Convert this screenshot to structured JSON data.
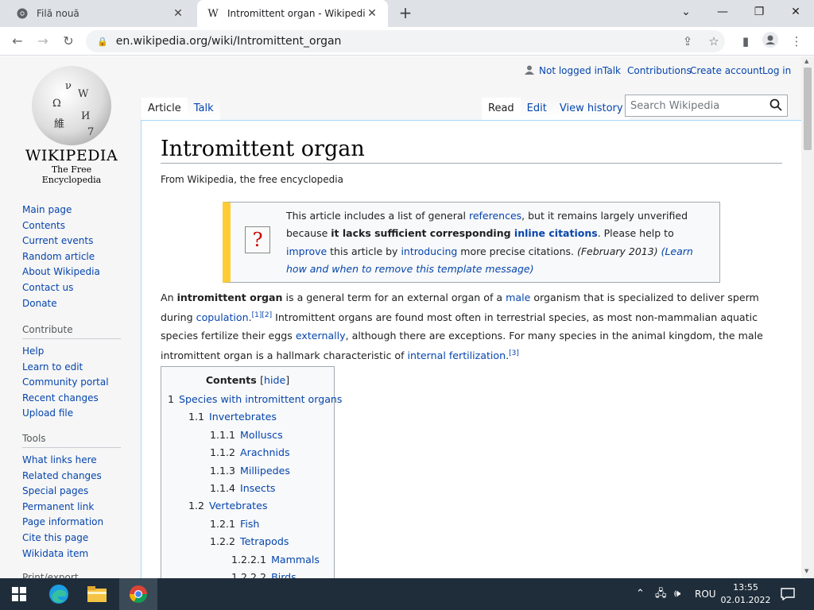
{
  "browser": {
    "tabs": [
      {
        "title": "Filă nouă",
        "favicon": "chrome-icon"
      },
      {
        "title": "Intromittent organ - Wikipedia",
        "favicon": "W"
      }
    ],
    "url": "en.wikipedia.org/wiki/Intromittent_organ"
  },
  "wiki": {
    "wordmark": "Wikipedia",
    "tagline": "The Free Encyclopedia",
    "user_tools": {
      "not_logged_in": "Not logged in",
      "talk": "Talk",
      "contributions": "Contributions",
      "create_account": "Create account",
      "log_in": "Log in"
    },
    "tabs_left": [
      "Article",
      "Talk"
    ],
    "tabs_right": [
      "Read",
      "Edit",
      "View history"
    ],
    "search_placeholder": "Search Wikipedia",
    "nav": [
      "Main page",
      "Contents",
      "Current events",
      "Random article",
      "About Wikipedia",
      "Contact us",
      "Donate"
    ],
    "contribute": {
      "heading": "Contribute",
      "items": [
        "Help",
        "Learn to edit",
        "Community portal",
        "Recent changes",
        "Upload file"
      ]
    },
    "tools": {
      "heading": "Tools",
      "items": [
        "What links here",
        "Related changes",
        "Special pages",
        "Permanent link",
        "Page information",
        "Cite this page",
        "Wikidata item"
      ]
    },
    "print_heading": "Print/export"
  },
  "article": {
    "title": "Intromittent organ",
    "from": "From Wikipedia, the free encyclopedia",
    "notice": {
      "p1": "This article includes a list of general ",
      "l1": "references",
      "p2": ", but it remains largely unverified because ",
      "b1": "it lacks sufficient corresponding ",
      "l2": "inline citations",
      "p3": ". Please help to ",
      "l3": "improve",
      "p4": " this article by ",
      "l4": "introducing",
      "p5": " more precise citations. ",
      "date": "(February 2013)",
      "learn": " (Learn how and when to remove this template message)"
    },
    "lead": {
      "t1": "An ",
      "b1": "intromittent organ",
      "t2": " is a general term for an external organ of a ",
      "l1": "male",
      "t3": " organism that is specialized to deliver sperm during ",
      "l2": "copulation",
      "t4": ".",
      "c1": "[1]",
      "c2": "[2]",
      "t5": " Intromittent organs are found most often in terrestrial species, as most non-mammalian aquatic species fertilize their eggs ",
      "l3": "externally",
      "t6": ", although there are exceptions. For many species in the animal kingdom, the male intromittent organ is a hallmark characteristic of ",
      "l4": "internal fertilization",
      "t7": ".",
      "c3": "[3]"
    },
    "toc": {
      "title": "Contents",
      "hide": "hide",
      "items": [
        {
          "num": "1",
          "text": "Species with intromittent organs"
        },
        {
          "num": "1.1",
          "text": "Invertebrates"
        },
        {
          "num": "1.1.1",
          "text": "Molluscs"
        },
        {
          "num": "1.1.2",
          "text": "Arachnids"
        },
        {
          "num": "1.1.3",
          "text": "Millipedes"
        },
        {
          "num": "1.1.4",
          "text": "Insects"
        },
        {
          "num": "1.2",
          "text": "Vertebrates"
        },
        {
          "num": "1.2.1",
          "text": "Fish"
        },
        {
          "num": "1.2.2",
          "text": "Tetrapods"
        },
        {
          "num": "1.2.2.1",
          "text": "Mammals"
        },
        {
          "num": "1.2.2.2",
          "text": "Birds"
        }
      ]
    }
  },
  "taskbar": {
    "language": "ROU",
    "time": "13:55",
    "date": "02.01.2022"
  }
}
